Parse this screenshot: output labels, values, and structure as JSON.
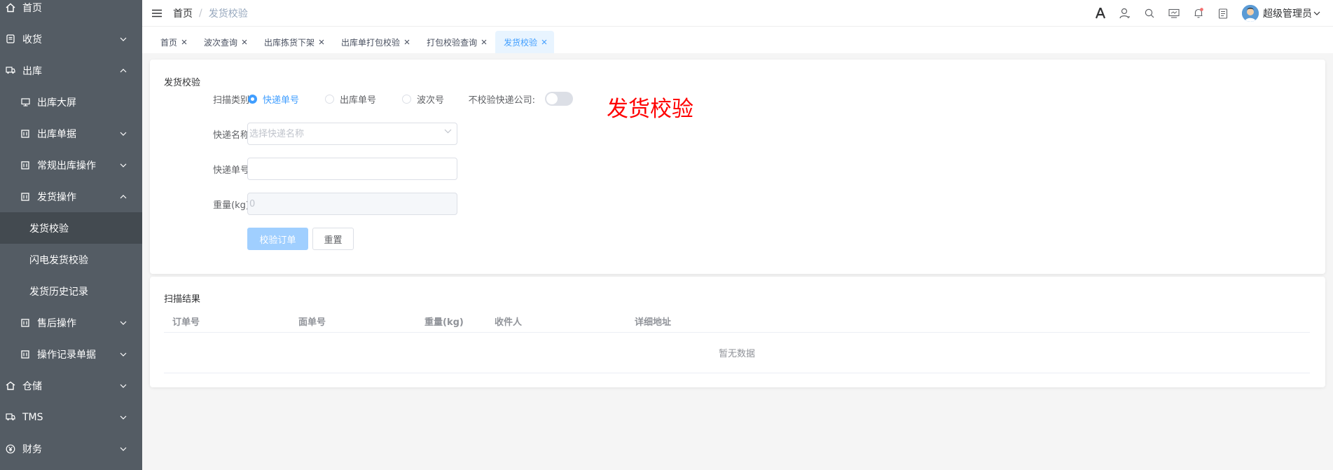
{
  "sidebar": {
    "items": [
      {
        "label": "首页",
        "icon": "home-icon"
      },
      {
        "label": "收货",
        "icon": "receipt-icon"
      },
      {
        "label": "出库",
        "icon": "truck-icon"
      },
      {
        "label": "出库大屏",
        "icon": "monitor-icon"
      },
      {
        "label": "出库单据",
        "icon": "document-icon"
      },
      {
        "label": "常规出库操作",
        "icon": "document-icon"
      },
      {
        "label": "发货操作",
        "icon": "document-icon"
      },
      {
        "label": "发货校验"
      },
      {
        "label": "闪电发货校验"
      },
      {
        "label": "发货历史记录"
      },
      {
        "label": "售后操作",
        "icon": "document-icon"
      },
      {
        "label": "操作记录单据",
        "icon": "document-icon"
      },
      {
        "label": "仓储",
        "icon": "warehouse-icon"
      },
      {
        "label": "TMS",
        "icon": "truck-icon"
      },
      {
        "label": "财务",
        "icon": "yen-icon"
      }
    ]
  },
  "header": {
    "breadcrumb_home": "首页",
    "breadcrumb_sep": "/",
    "breadcrumb_current": "发货校验",
    "username": "超级管理员"
  },
  "tabs": [
    {
      "label": "首页"
    },
    {
      "label": "波次查询"
    },
    {
      "label": "出库拣货下架"
    },
    {
      "label": "出库单打包校验"
    },
    {
      "label": "打包校验查询"
    },
    {
      "label": "发货校验",
      "active": true
    }
  ],
  "form": {
    "section_title": "发货校验",
    "scan_type_label": "扫描类别",
    "scan_options": [
      "快递单号",
      "出库单号",
      "波次号"
    ],
    "no_check_label": "不校验快递公司:",
    "express_name_label": "快递名称",
    "express_name_placeholder": "选择快递名称",
    "express_no_label": "快递单号",
    "express_no_value": "",
    "weight_label": "重量(kg)",
    "weight_placeholder": "0",
    "verify_button": "校验订单",
    "reset_button": "重置",
    "big_title": "发货校验"
  },
  "results": {
    "title": "扫描结果",
    "columns": [
      "订单号",
      "面单号",
      "重量(kg)",
      "收件人",
      "详细地址"
    ],
    "empty_text": "暂无数据"
  },
  "colors": {
    "sidebar_bg": "#545c64",
    "accent": "#409eff",
    "big_title": "#ff0000"
  }
}
